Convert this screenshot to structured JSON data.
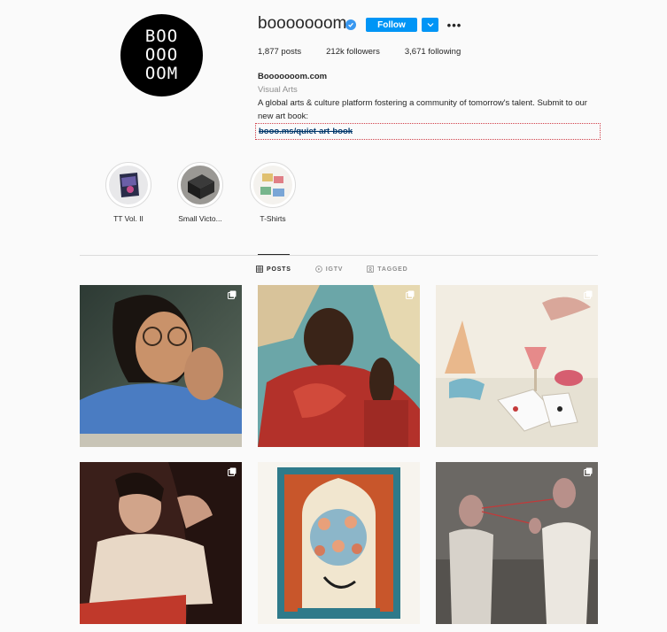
{
  "profile": {
    "avatar_text": "BOO\nOOO\nOOM",
    "username": "booooooom",
    "follow_label": "Follow",
    "more_label": "•••",
    "stats": {
      "posts": "1,877 posts",
      "followers": "212k followers",
      "following": "3,671 following"
    },
    "bio": {
      "name": "Booooooom.com",
      "category": "Visual Arts",
      "text": "A global arts & culture platform fostering a community of tomorrow's talent. Submit to our new art book:",
      "link": "booo.ms/quiet-art-book"
    }
  },
  "highlights": [
    {
      "label": "TT Vol. II",
      "icon": "book-cover"
    },
    {
      "label": "Small Victo...",
      "icon": "black-box"
    },
    {
      "label": "T-Shirts",
      "icon": "tshirts"
    }
  ],
  "tabs": [
    {
      "label": "POSTS",
      "icon": "grid-icon",
      "active": true
    },
    {
      "label": "IGTV",
      "icon": "igtv-icon",
      "active": false
    },
    {
      "label": "TAGGED",
      "icon": "tag-icon",
      "active": false
    }
  ],
  "posts": [
    {
      "subject": "woman-with-glasses-portrait"
    },
    {
      "subject": "man-in-red-sweater-painting"
    },
    {
      "subject": "surreal-table-with-cards-and-mask"
    },
    {
      "subject": "woman-reclining-portrait"
    },
    {
      "subject": "arched-window-illustration"
    },
    {
      "subject": "two-people-with-string"
    }
  ],
  "colors": {
    "accent": "#0095f6",
    "verified": "#3897f0",
    "background": "#fafafa",
    "text": "#262626",
    "muted": "#8e8e8e"
  }
}
